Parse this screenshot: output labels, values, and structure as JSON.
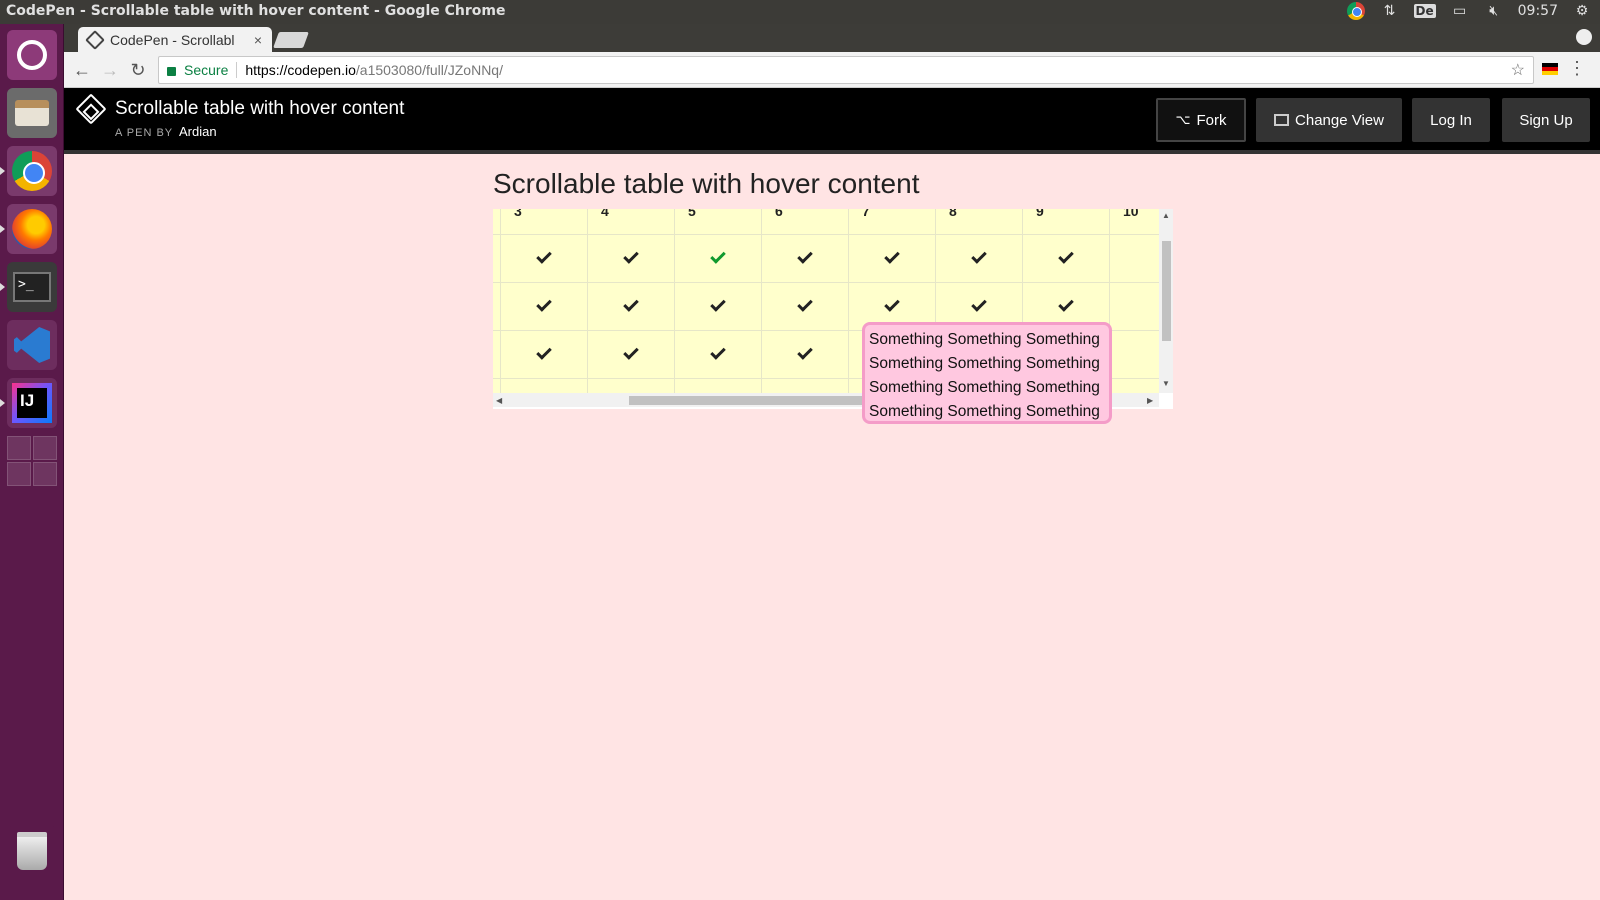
{
  "os": {
    "window_title": "CodePen - Scrollable table with hover content - Google Chrome",
    "keyboard_layout": "De",
    "clock": "09:57"
  },
  "browser": {
    "tab_title": "CodePen - Scrollabl",
    "tab_close": "×",
    "secure_label": "Secure",
    "url_host": "https://codepen.io",
    "url_path": "/a1503080/full/JZoNNq/"
  },
  "codepen": {
    "pen_title": "Scrollable table with hover content",
    "by_label": "A PEN BY",
    "author": "Ardian",
    "fork_label": "Fork",
    "change_view_label": "Change View",
    "login_label": "Log In",
    "signup_label": "Sign Up"
  },
  "page": {
    "heading": "Scrollable table with hover content",
    "table": {
      "column_headers": [
        "3",
        "4",
        "5",
        "6",
        "7",
        "8",
        "9",
        "10"
      ],
      "rows": [
        [
          "check",
          "check",
          "check-green",
          "check",
          "check",
          "check",
          "check",
          ""
        ],
        [
          "check",
          "check",
          "check",
          "check",
          "check",
          "check",
          "check",
          ""
        ],
        [
          "check",
          "check",
          "check",
          "check",
          "",
          "",
          "",
          ""
        ]
      ]
    },
    "tooltip_lines": [
      "Something Something Something",
      "Something Something Something",
      "Something Something Something",
      "Something Something Something"
    ]
  },
  "colors": {
    "page_bg": "#ffe4e4",
    "table_bg": "#ffffcc",
    "tooltip_bg": "#ffc8e0",
    "tooltip_border": "#f49cc8",
    "check_green": "#109a2e",
    "launcher_bg": "#5a1a4a"
  }
}
